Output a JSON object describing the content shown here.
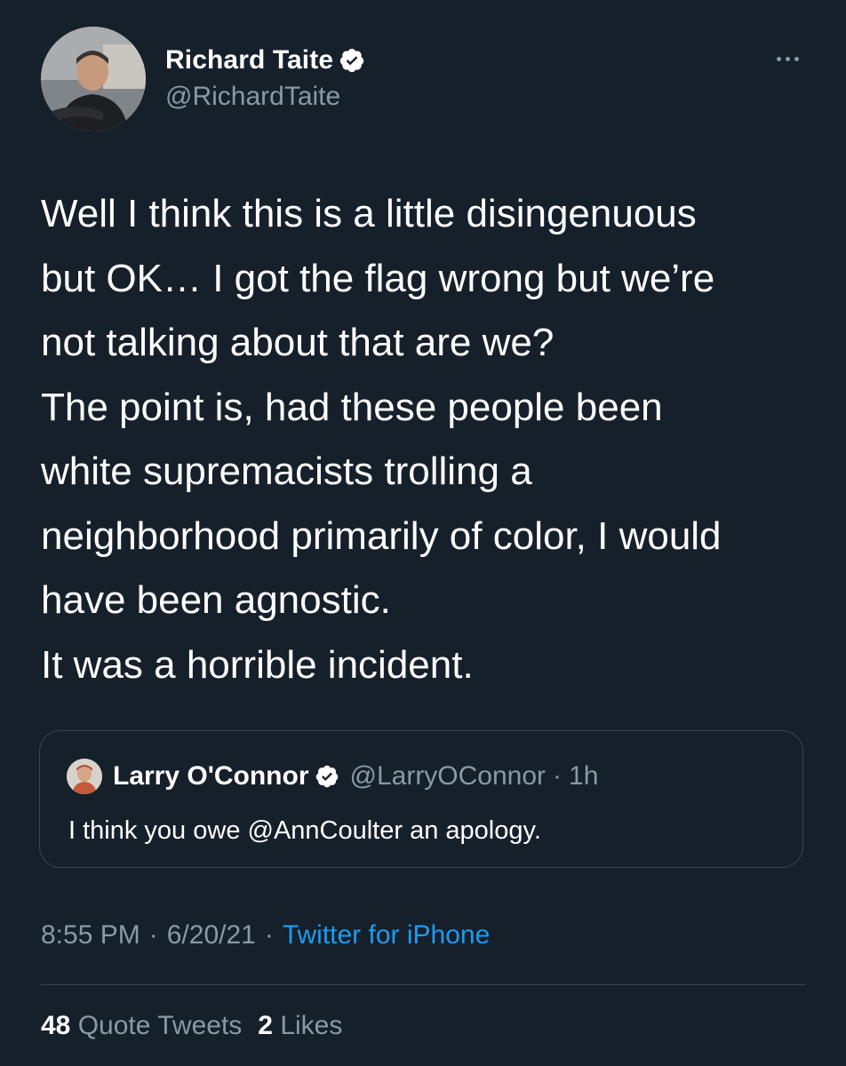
{
  "tweet": {
    "author": {
      "display_name": "Richard Taite",
      "handle": "@RichardTaite",
      "verified": true,
      "avatar_icon": "profile-photo"
    },
    "text_lines": [
      "Well I think this is a little disingenuous",
      "but OK… I got the flag wrong but we’re",
      "not talking about that are we?",
      "The point is, had these people been",
      "white supremacists trolling a",
      "neighborhood primarily of color, I would",
      "have been agnostic.",
      "It was a horrible incident."
    ],
    "quoted": {
      "display_name": "Larry O'Connor",
      "handle": "@LarryOConnor",
      "separator": "·",
      "time": "1h",
      "text": "I think you owe @AnnCoulter an apology."
    },
    "meta": {
      "time": "8:55 PM",
      "date": "6/20/21",
      "separator": "·",
      "source": "Twitter for iPhone"
    },
    "stats": {
      "quote_tweets_count": "48",
      "quote_tweets_label": "Quote Tweets",
      "likes_count": "2",
      "likes_label": "Likes"
    }
  },
  "colors": {
    "background": "#15202b",
    "text_primary": "#ffffff",
    "text_secondary": "#8b98a5",
    "link": "#1d9bf0",
    "border": "#38444d"
  }
}
